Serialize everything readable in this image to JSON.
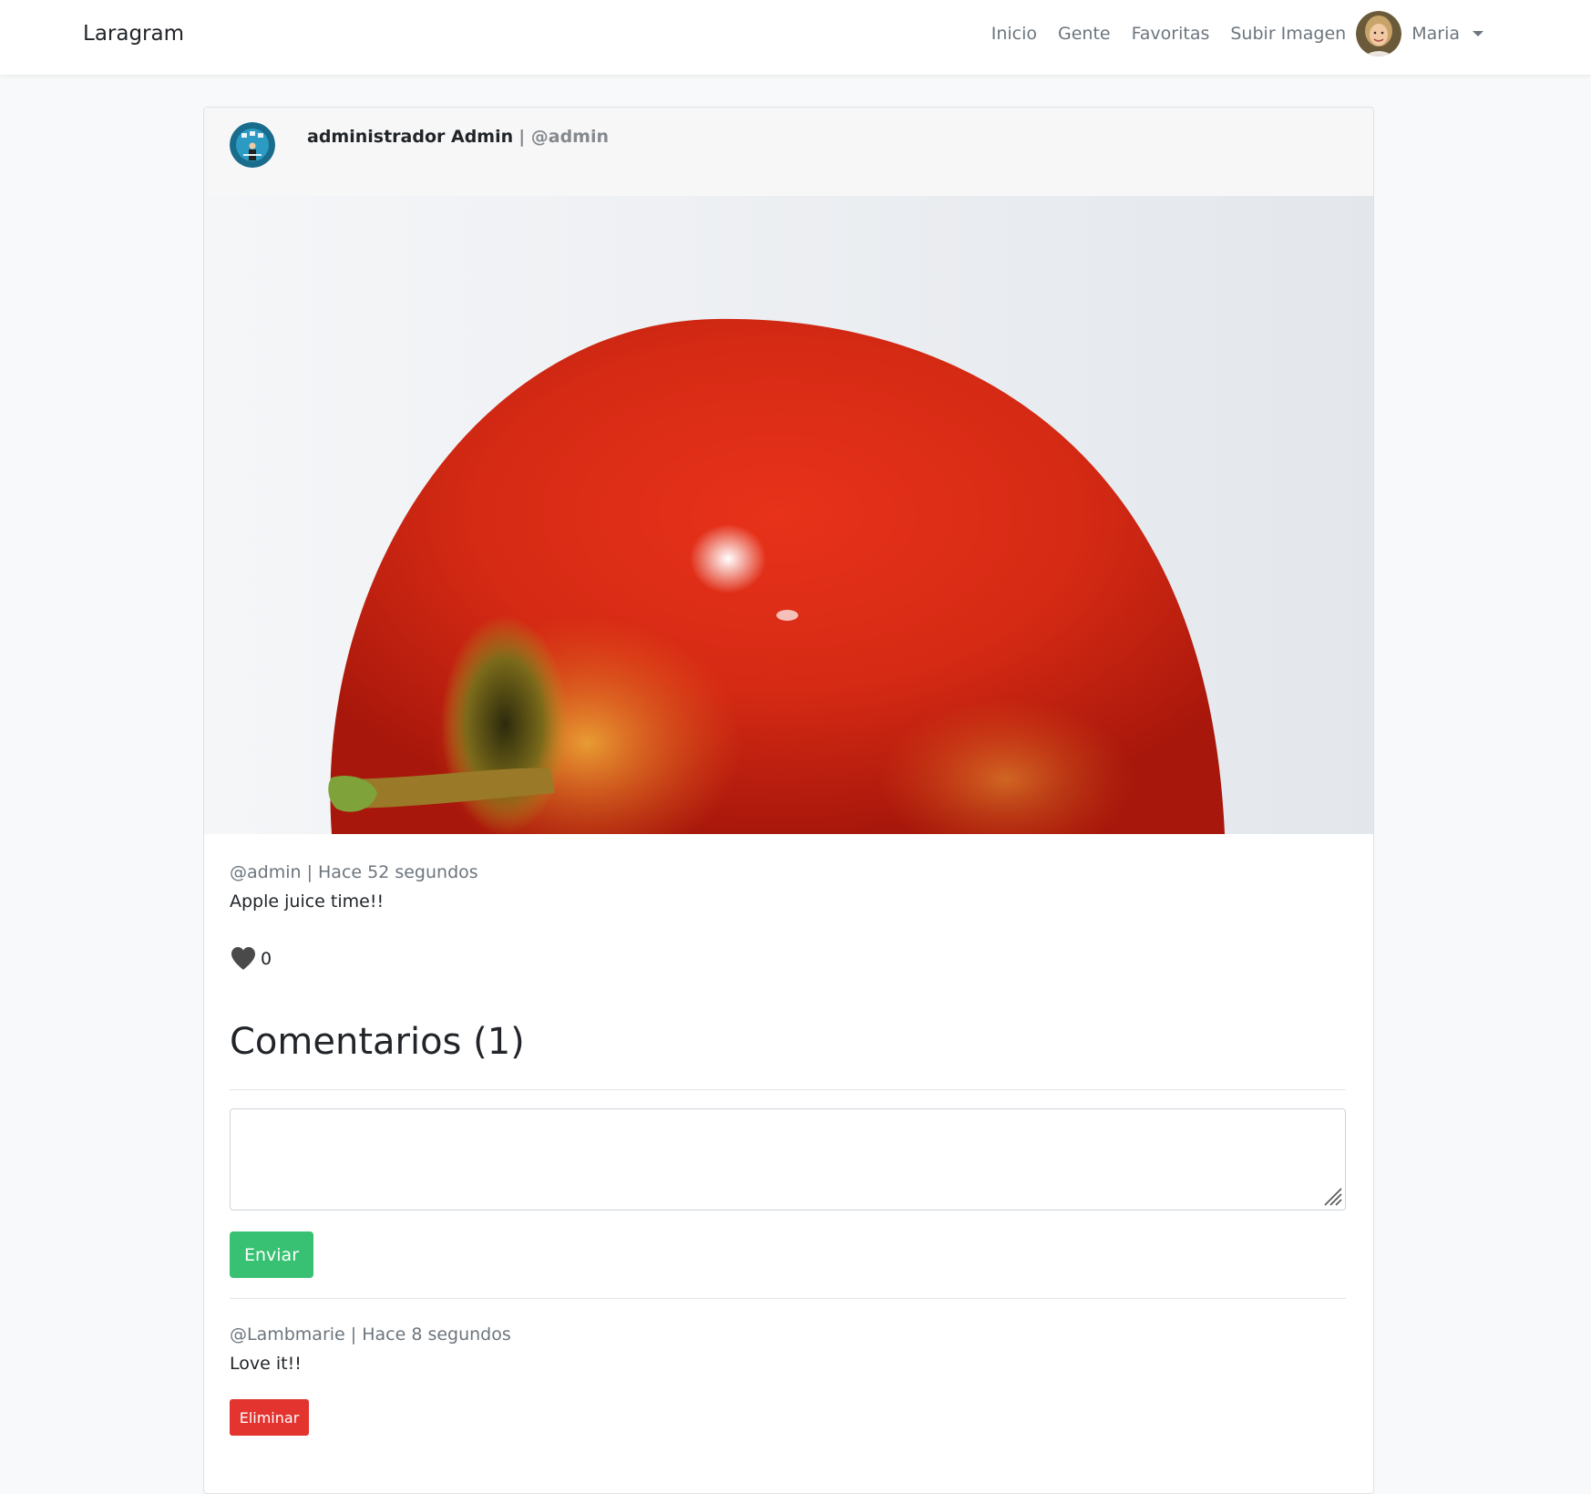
{
  "navbar": {
    "brand": "Laragram",
    "links": [
      "Inicio",
      "Gente",
      "Favoritas",
      "Subir Imagen"
    ],
    "user_name": "Maria"
  },
  "post": {
    "author_name": "administrador Admin",
    "author_handle": "| @admin",
    "image_alt": "red-apple-photo",
    "meta": "@admin | Hace 52 segundos",
    "description": "Apple juice time!!",
    "like_icon": "heart-icon",
    "likes": "0"
  },
  "comments": {
    "title": "Comentarios (1)",
    "input_value": "",
    "send_label": "Enviar",
    "items": [
      {
        "meta": "@Lambmarie | Hace 8 segundos",
        "text": "Love it!!",
        "delete_label": "Eliminar"
      }
    ]
  },
  "colors": {
    "accent_success": "#38c172",
    "accent_danger": "#e3342f",
    "muted_text": "#6c757d"
  }
}
